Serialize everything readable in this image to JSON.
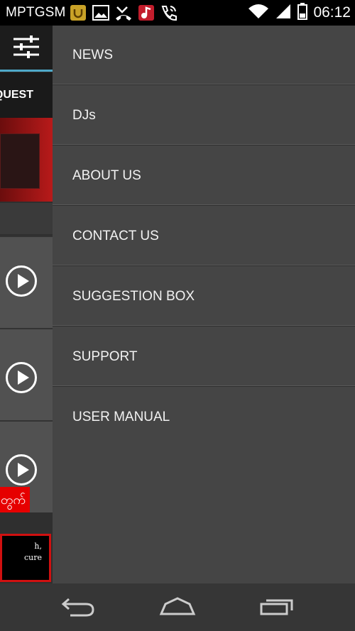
{
  "status_bar": {
    "carrier": "MPTGSM",
    "time": "06:12",
    "icons": [
      "notification-app-icon",
      "image-icon",
      "missed-call-icon",
      "music-app-icon",
      "call-icon",
      "wifi-icon",
      "signal-icon",
      "battery-icon"
    ]
  },
  "left_pane": {
    "tab_label": "QUEST",
    "red_label": "တွက်",
    "promo_lines": [
      "h,",
      "cure"
    ],
    "accent_color": "#4ea9c9"
  },
  "drawer": {
    "items": [
      {
        "label": "NEWS"
      },
      {
        "label": "DJs"
      },
      {
        "label": "ABOUT US"
      },
      {
        "label": "CONTACT US"
      },
      {
        "label": "SUGGESTION BOX"
      },
      {
        "label": "SUPPORT"
      },
      {
        "label": "USER MANUAL"
      }
    ]
  },
  "nav_bar": {
    "buttons": [
      "back-icon",
      "home-icon",
      "recents-icon"
    ]
  }
}
